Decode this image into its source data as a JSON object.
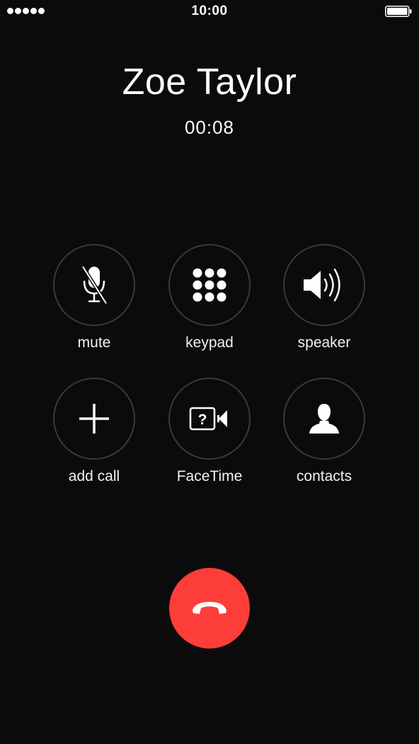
{
  "status_bar": {
    "time": "10:00",
    "signal_bars": 5,
    "signal_icon": "signal-dots-icon",
    "battery_icon": "battery-full-icon",
    "battery_level": 1.0
  },
  "call": {
    "caller_name": "Zoe Taylor",
    "duration": "00:08"
  },
  "controls": [
    {
      "label": "mute",
      "icon": "microphone-muted-icon"
    },
    {
      "label": "keypad",
      "icon": "keypad-grid-icon"
    },
    {
      "label": "speaker",
      "icon": "speaker-icon"
    },
    {
      "label": "add call",
      "icon": "plus-icon"
    },
    {
      "label": "FaceTime",
      "icon": "facetime-unavailable-icon"
    },
    {
      "label": "contacts",
      "icon": "person-silhouette-icon"
    }
  ],
  "end_call": {
    "icon": "phone-hangup-icon"
  },
  "colors": {
    "background": "#0b0b0b",
    "text": "#ffffff",
    "button_border": "#3a3a3a",
    "end_call": "#fc3d39"
  }
}
